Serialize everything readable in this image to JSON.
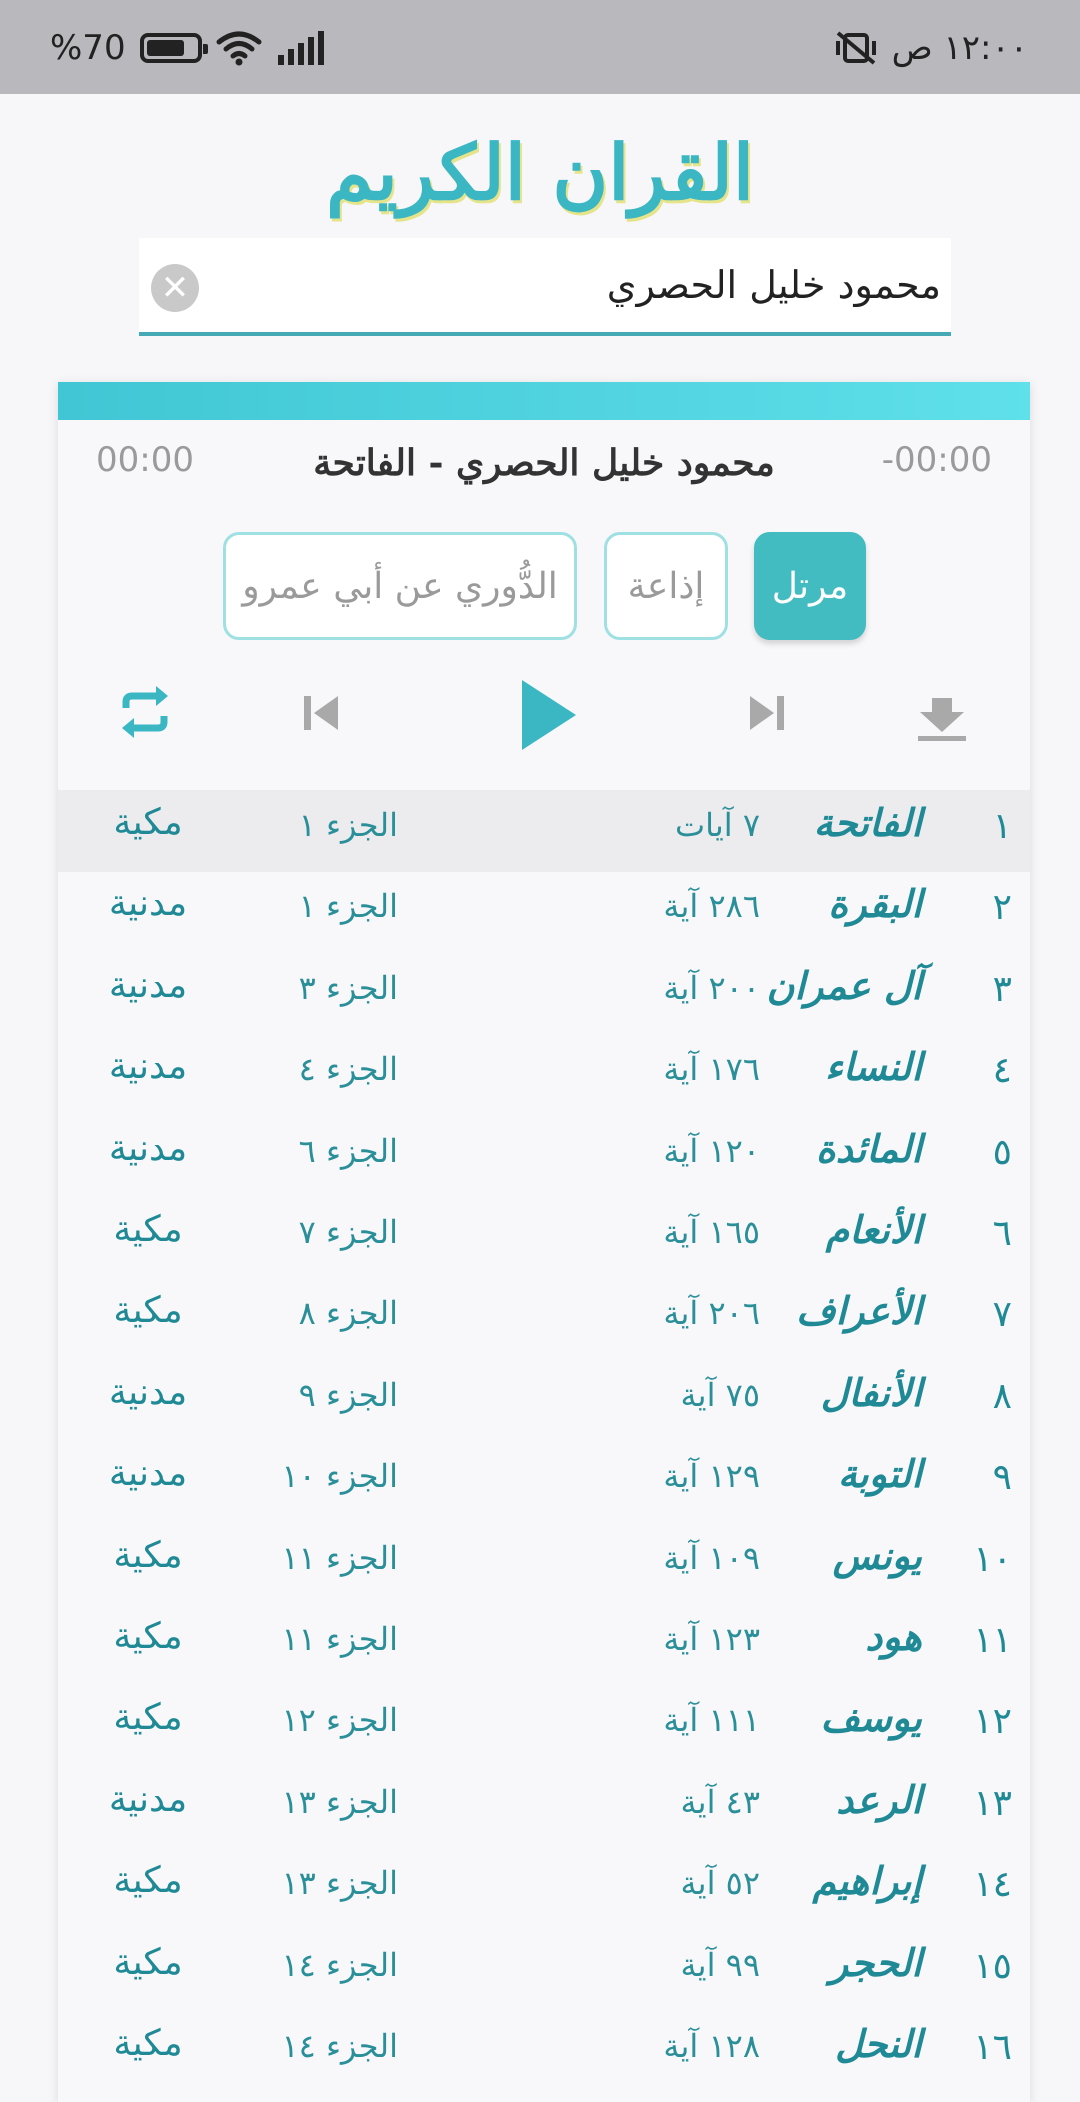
{
  "status_bar": {
    "battery_text": "%70",
    "time": "١٢:٠٠ ص",
    "icons": [
      "battery-icon",
      "wifi-icon",
      "signal-icon",
      "vibrate-off-icon"
    ]
  },
  "header": {
    "title": "القران الكريم"
  },
  "search": {
    "value": "محمود خليل الحصري",
    "placeholder": ""
  },
  "player": {
    "elapsed": "00:00",
    "remaining": "-00:00",
    "track_title": "محمود خليل الحصري - الفاتحة",
    "modes": {
      "murattal": "مرتل",
      "broadcast": "إذاعة",
      "riwaya": "الدُّوري عن أبي عمرو"
    },
    "accent_color": "#42bcc0"
  },
  "surahs": [
    {
      "num": "١",
      "name": "الفاتحة",
      "ayat": "٧ آيات",
      "juz": "الجزء ١",
      "type": "مكية"
    },
    {
      "num": "٢",
      "name": "البقرة",
      "ayat": "٢٨٦ آية",
      "juz": "الجزء ١",
      "type": "مدنية"
    },
    {
      "num": "٣",
      "name": "آل عمران",
      "ayat": "٢٠٠ آية",
      "juz": "الجزء ٣",
      "type": "مدنية"
    },
    {
      "num": "٤",
      "name": "النساء",
      "ayat": "١٧٦ آية",
      "juz": "الجزء ٤",
      "type": "مدنية"
    },
    {
      "num": "٥",
      "name": "المائدة",
      "ayat": "١٢٠ آية",
      "juz": "الجزء ٦",
      "type": "مدنية"
    },
    {
      "num": "٦",
      "name": "الأنعام",
      "ayat": "١٦٥ آية",
      "juz": "الجزء ٧",
      "type": "مكية"
    },
    {
      "num": "٧",
      "name": "الأعراف",
      "ayat": "٢٠٦ آية",
      "juz": "الجزء ٨",
      "type": "مكية"
    },
    {
      "num": "٨",
      "name": "الأنفال",
      "ayat": "٧٥ آية",
      "juz": "الجزء ٩",
      "type": "مدنية"
    },
    {
      "num": "٩",
      "name": "التوبة",
      "ayat": "١٢٩ آية",
      "juz": "الجزء ١٠",
      "type": "مدنية"
    },
    {
      "num": "١٠",
      "name": "يونس",
      "ayat": "١٠٩ آية",
      "juz": "الجزء ١١",
      "type": "مكية"
    },
    {
      "num": "١١",
      "name": "هود",
      "ayat": "١٢٣ آية",
      "juz": "الجزء ١١",
      "type": "مكية"
    },
    {
      "num": "١٢",
      "name": "يوسف",
      "ayat": "١١١ آية",
      "juz": "الجزء ١٢",
      "type": "مكية"
    },
    {
      "num": "١٣",
      "name": "الرعد",
      "ayat": "٤٣ آية",
      "juz": "الجزء ١٣",
      "type": "مدنية"
    },
    {
      "num": "١٤",
      "name": "إبراهيم",
      "ayat": "٥٢ آية",
      "juz": "الجزء ١٣",
      "type": "مكية"
    },
    {
      "num": "١٥",
      "name": "الحجر",
      "ayat": "٩٩ آية",
      "juz": "الجزء ١٤",
      "type": "مكية"
    },
    {
      "num": "١٦",
      "name": "النحل",
      "ayat": "١٢٨ آية",
      "juz": "الجزء ١٤",
      "type": "مكية"
    }
  ]
}
